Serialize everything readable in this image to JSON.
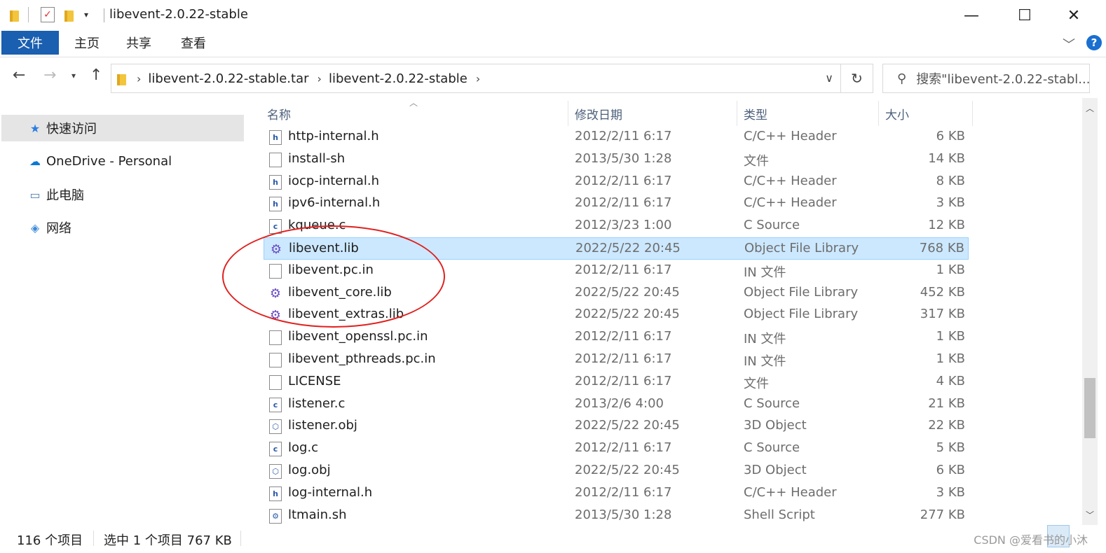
{
  "window": {
    "title": "libevent-2.0.22-stable",
    "minimize_glyph": "—",
    "maximize_glyph": "☐",
    "close_glyph": "✕"
  },
  "ribbon": {
    "tabs": [
      "文件",
      "主页",
      "共享",
      "查看"
    ],
    "help": "?"
  },
  "address": {
    "crumbs": [
      "libevent-2.0.22-stable.tar",
      "libevent-2.0.22-stable"
    ],
    "search_placeholder": "搜索\"libevent-2.0.22-stabl..."
  },
  "nav": {
    "items": [
      "快速访问",
      "OneDrive - Personal",
      "此电脑",
      "网络"
    ]
  },
  "columns": {
    "name": "名称",
    "date": "修改日期",
    "type": "类型",
    "size": "大小"
  },
  "files": [
    {
      "name": "http-internal.h",
      "date": "2012/2/11 6:17",
      "type": "C/C++ Header",
      "size": "6 KB",
      "icon": "h-file-icon"
    },
    {
      "name": "install-sh",
      "date": "2013/5/30 1:28",
      "type": "文件",
      "size": "14 KB",
      "icon": "file-icon"
    },
    {
      "name": "iocp-internal.h",
      "date": "2012/2/11 6:17",
      "type": "C/C++ Header",
      "size": "8 KB",
      "icon": "h-file-icon"
    },
    {
      "name": "ipv6-internal.h",
      "date": "2012/2/11 6:17",
      "type": "C/C++ Header",
      "size": "3 KB",
      "icon": "h-file-icon"
    },
    {
      "name": "kqueue.c",
      "date": "2012/3/23 1:00",
      "type": "C Source",
      "size": "12 KB",
      "icon": "c-file-icon"
    },
    {
      "name": "libevent.lib",
      "date": "2022/5/22 20:45",
      "type": "Object File Library",
      "size": "768 KB",
      "icon": "lib-file-icon",
      "selected": true
    },
    {
      "name": "libevent.pc.in",
      "date": "2012/2/11 6:17",
      "type": "IN 文件",
      "size": "1 KB",
      "icon": "file-icon"
    },
    {
      "name": "libevent_core.lib",
      "date": "2022/5/22 20:45",
      "type": "Object File Library",
      "size": "452 KB",
      "icon": "lib-file-icon"
    },
    {
      "name": "libevent_extras.lib",
      "date": "2022/5/22 20:45",
      "type": "Object File Library",
      "size": "317 KB",
      "icon": "lib-file-icon"
    },
    {
      "name": "libevent_openssl.pc.in",
      "date": "2012/2/11 6:17",
      "type": "IN 文件",
      "size": "1 KB",
      "icon": "file-icon"
    },
    {
      "name": "libevent_pthreads.pc.in",
      "date": "2012/2/11 6:17",
      "type": "IN 文件",
      "size": "1 KB",
      "icon": "file-icon"
    },
    {
      "name": "LICENSE",
      "date": "2012/2/11 6:17",
      "type": "文件",
      "size": "4 KB",
      "icon": "file-icon"
    },
    {
      "name": "listener.c",
      "date": "2013/2/6 4:00",
      "type": "C Source",
      "size": "21 KB",
      "icon": "c-file-icon"
    },
    {
      "name": "listener.obj",
      "date": "2022/5/22 20:45",
      "type": "3D Object",
      "size": "22 KB",
      "icon": "obj-file-icon"
    },
    {
      "name": "log.c",
      "date": "2012/2/11 6:17",
      "type": "C Source",
      "size": "5 KB",
      "icon": "c-file-icon"
    },
    {
      "name": "log.obj",
      "date": "2022/5/22 20:45",
      "type": "3D Object",
      "size": "6 KB",
      "icon": "obj-file-icon"
    },
    {
      "name": "log-internal.h",
      "date": "2012/2/11 6:17",
      "type": "C/C++ Header",
      "size": "3 KB",
      "icon": "h-file-icon"
    },
    {
      "name": "ltmain.sh",
      "date": "2013/5/30 1:28",
      "type": "Shell Script",
      "size": "277 KB",
      "icon": "sh-file-icon"
    }
  ],
  "status": {
    "count": "116 个项目",
    "selection": "选中 1 个项目  767 KB",
    "watermark": "CSDN @爱看书的小沐"
  }
}
